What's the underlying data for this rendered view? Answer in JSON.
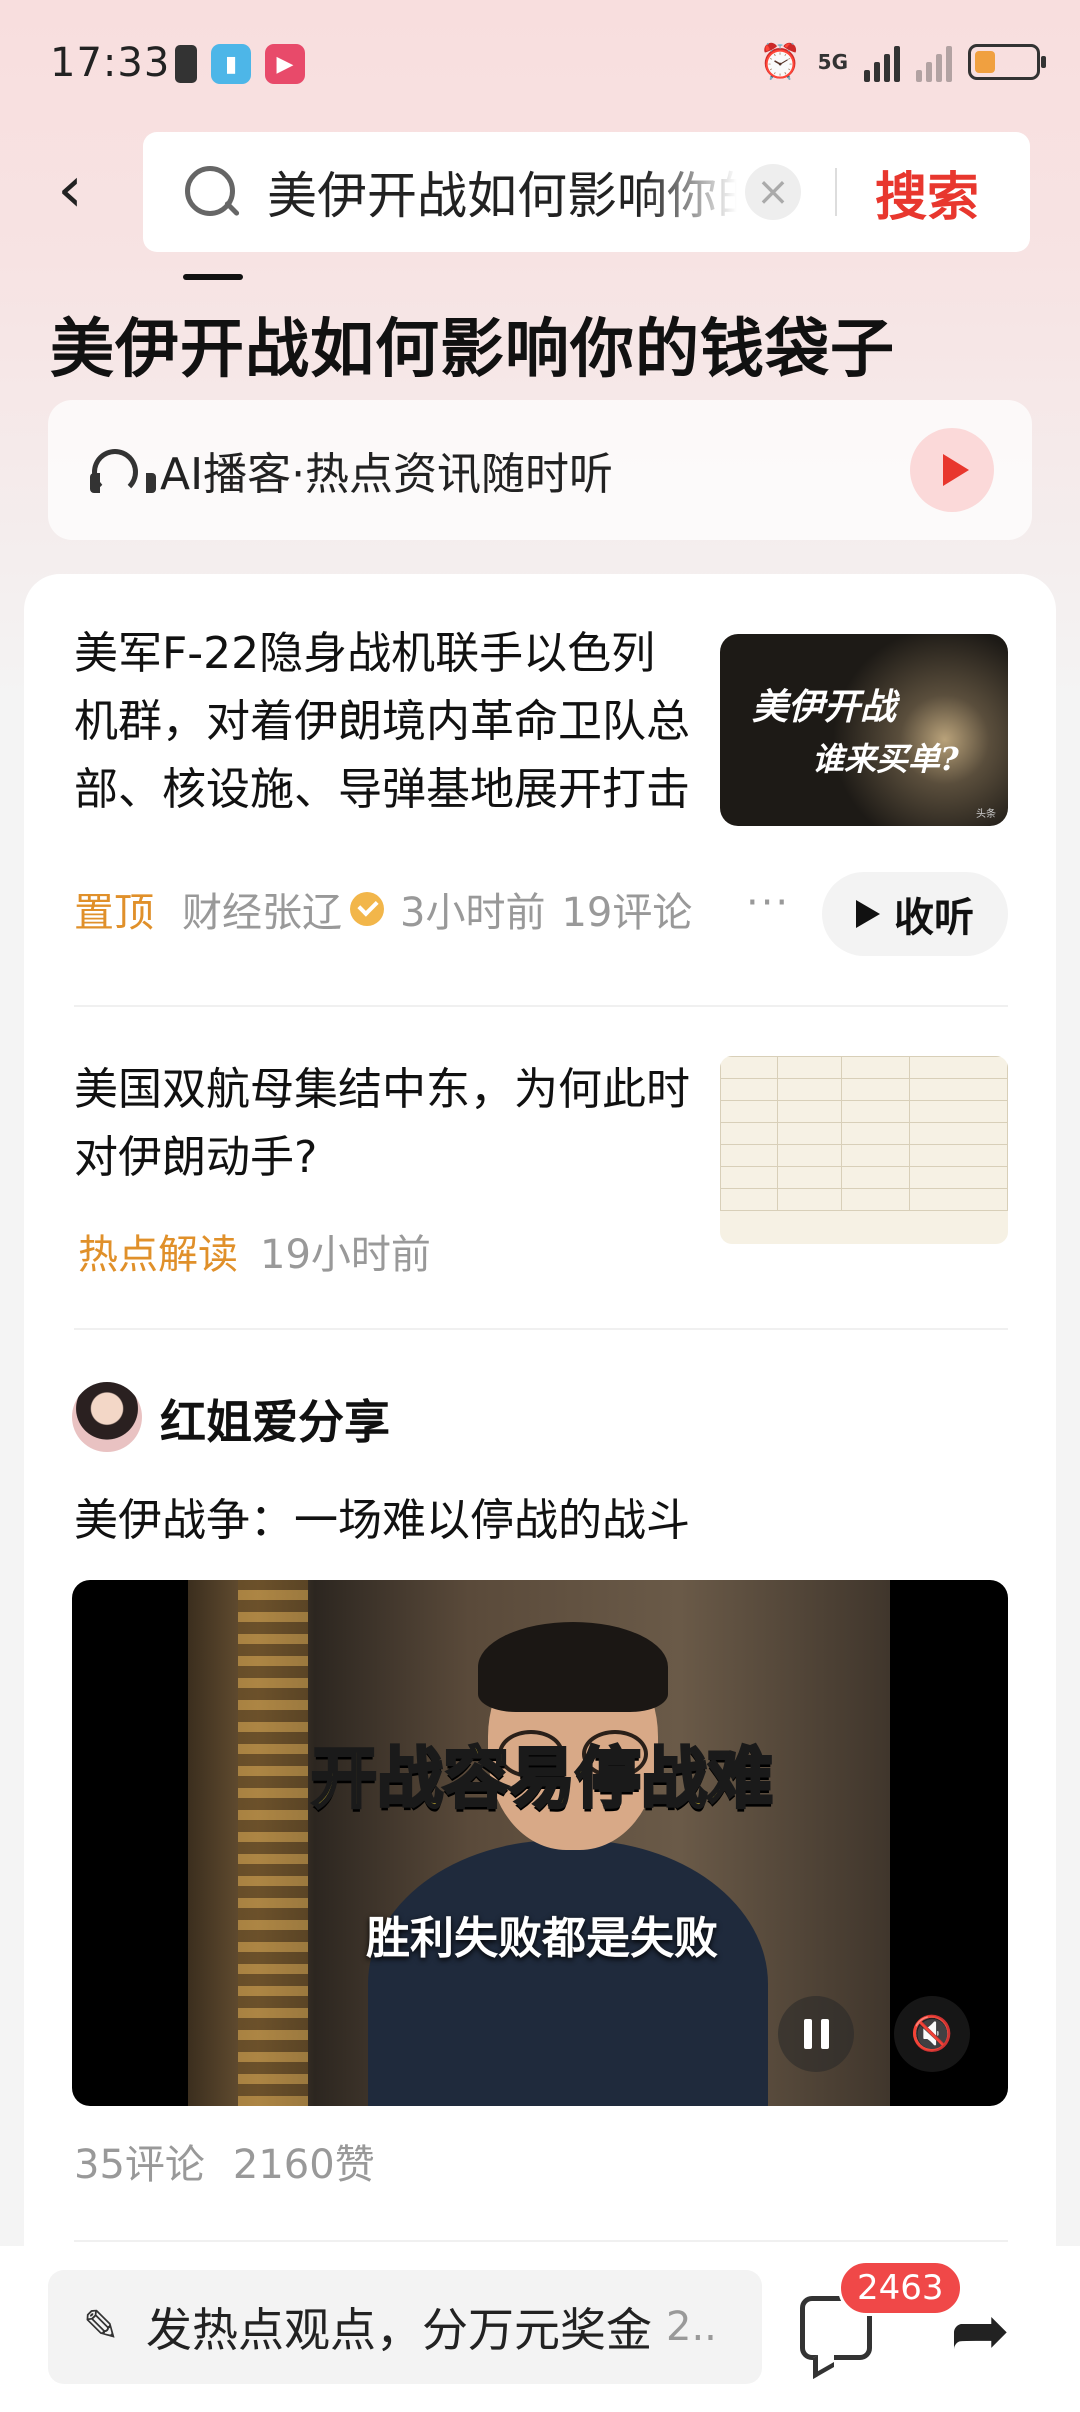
{
  "status_bar": {
    "time": "17:33",
    "network": "5G",
    "battery_level": 0.34,
    "colors": {
      "battery_fill": "#f0a040"
    }
  },
  "search": {
    "query": "美伊开战如何影响你的钱袋子",
    "button_label": "搜索"
  },
  "page": {
    "title": "美伊开战如何影响你的钱袋子"
  },
  "podcast": {
    "label": "AI播客·热点资讯随时听"
  },
  "news": [
    {
      "title": "美军F-22隐身战机联手以色列机群，对着伊朗境内革命卫队总部、核设施、导弹基地展开打击",
      "tag": "置顶",
      "author": "财经张辽",
      "time": "3小时前",
      "comments": "19评论",
      "listen_label": "收听",
      "thumb_line1": "美伊开战",
      "thumb_line2": "谁来买单?",
      "thumb_source": "头条"
    },
    {
      "title": "美国双航母集结中东，为何此时对伊朗动手?",
      "tag": "热点解读",
      "time": "19小时前"
    }
  ],
  "post": {
    "author": "红姐爱分享",
    "title": "美伊战争：一场难以停战的战斗",
    "video_caption_main": "开战容易停战难",
    "video_caption_sub": "胜利失败都是失败",
    "comments": "35评论",
    "likes": "2160赞"
  },
  "bottom_bar": {
    "placeholder": "发热点观点，分万元奖金",
    "inline_count": "2..",
    "message_badge": "2463"
  },
  "colors": {
    "accent_red": "#e8372e",
    "tag_orange": "#e0902a"
  }
}
